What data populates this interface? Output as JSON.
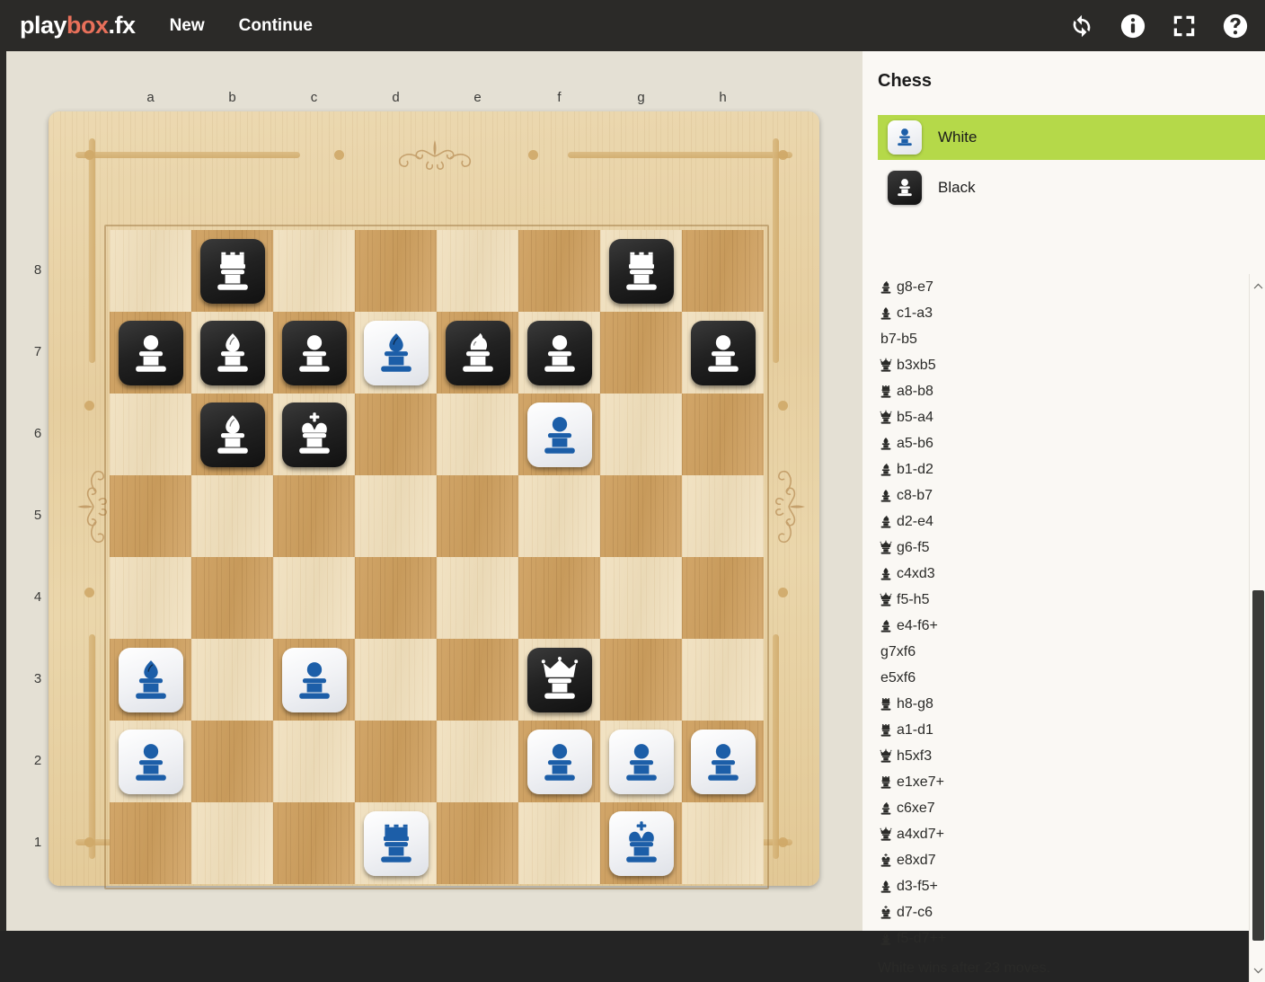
{
  "app": {
    "logo_play": "play",
    "logo_box": "box",
    "logo_fx": ".fx",
    "nav": [
      {
        "label": "New",
        "name": "nav-new"
      },
      {
        "label": "Continue",
        "name": "nav-continue"
      }
    ],
    "icons": [
      {
        "name": "refresh-icon",
        "title": "Restart"
      },
      {
        "name": "info-icon",
        "title": "Info"
      },
      {
        "name": "fullscreen-icon",
        "title": "Fullscreen"
      },
      {
        "name": "help-icon",
        "title": "Help"
      }
    ]
  },
  "sidebar": {
    "title": "Chess",
    "players": [
      {
        "name": "White",
        "color": "white",
        "active": true
      },
      {
        "name": "Black",
        "color": "black",
        "active": false
      }
    ],
    "result": "White wins after 23 moves.",
    "moves": [
      {
        "piece": "knight-black",
        "text": "g8-e7"
      },
      {
        "piece": "bishop-black",
        "text": "c1-a3"
      },
      {
        "piece": "",
        "text": "b7-b5"
      },
      {
        "piece": "queen-black",
        "text": "b3xb5"
      },
      {
        "piece": "rook-black",
        "text": "a8-b8"
      },
      {
        "piece": "queen-black",
        "text": "b5-a4"
      },
      {
        "piece": "bishop-black",
        "text": "a5-b6"
      },
      {
        "piece": "knight-black",
        "text": "b1-d2"
      },
      {
        "piece": "bishop-black",
        "text": "c8-b7"
      },
      {
        "piece": "knight-black",
        "text": "d2-e4"
      },
      {
        "piece": "queen-black",
        "text": "g6-f5"
      },
      {
        "piece": "bishop-black",
        "text": "c4xd3"
      },
      {
        "piece": "queen-black",
        "text": "f5-h5"
      },
      {
        "piece": "knight-black",
        "text": "e4-f6+"
      },
      {
        "piece": "",
        "text": "g7xf6"
      },
      {
        "piece": "",
        "text": "e5xf6"
      },
      {
        "piece": "rook-black",
        "text": "h8-g8"
      },
      {
        "piece": "rook-black",
        "text": "a1-d1"
      },
      {
        "piece": "queen-black",
        "text": "h5xf3"
      },
      {
        "piece": "rook-black",
        "text": "e1xe7+"
      },
      {
        "piece": "knight-black",
        "text": "c6xe7"
      },
      {
        "piece": "queen-black",
        "text": "a4xd7+"
      },
      {
        "piece": "king-black",
        "text": "e8xd7"
      },
      {
        "piece": "bishop-black",
        "text": "d3-f5+"
      },
      {
        "piece": "king-black",
        "text": "d7-c6"
      },
      {
        "piece": "bishop-black",
        "text": "f5-d7++"
      }
    ]
  },
  "board": {
    "files": [
      "a",
      "b",
      "c",
      "d",
      "e",
      "f",
      "g",
      "h"
    ],
    "ranks": [
      "8",
      "7",
      "6",
      "5",
      "4",
      "3",
      "2",
      "1"
    ],
    "colors": {
      "light_square": "#efdfc0",
      "dark_square": "#cca168",
      "frame": "#e7d2a4",
      "page_background": "#e4e0d4",
      "topbar": "#2b2a28",
      "accent_green": "#b5d949",
      "piece_white_fill": "#1c5ea8",
      "piece_black_fill": "#ffffff"
    },
    "pieces": [
      {
        "square": "b8",
        "color": "black",
        "type": "rook"
      },
      {
        "square": "g8",
        "color": "black",
        "type": "rook"
      },
      {
        "square": "a7",
        "color": "black",
        "type": "pawn"
      },
      {
        "square": "b7",
        "color": "black",
        "type": "bishop"
      },
      {
        "square": "c7",
        "color": "black",
        "type": "pawn"
      },
      {
        "square": "d7",
        "color": "white",
        "type": "bishop"
      },
      {
        "square": "e7",
        "color": "black",
        "type": "knight"
      },
      {
        "square": "f7",
        "color": "black",
        "type": "pawn"
      },
      {
        "square": "h7",
        "color": "black",
        "type": "pawn"
      },
      {
        "square": "b6",
        "color": "black",
        "type": "bishop"
      },
      {
        "square": "c6",
        "color": "black",
        "type": "king"
      },
      {
        "square": "f6",
        "color": "white",
        "type": "pawn"
      },
      {
        "square": "a3",
        "color": "white",
        "type": "bishop"
      },
      {
        "square": "c3",
        "color": "white",
        "type": "pawn"
      },
      {
        "square": "f3",
        "color": "black",
        "type": "queen"
      },
      {
        "square": "a2",
        "color": "white",
        "type": "pawn"
      },
      {
        "square": "f2",
        "color": "white",
        "type": "pawn"
      },
      {
        "square": "g2",
        "color": "white",
        "type": "pawn"
      },
      {
        "square": "h2",
        "color": "white",
        "type": "pawn"
      },
      {
        "square": "d1",
        "color": "white",
        "type": "rook"
      },
      {
        "square": "g1",
        "color": "white",
        "type": "king"
      }
    ]
  }
}
